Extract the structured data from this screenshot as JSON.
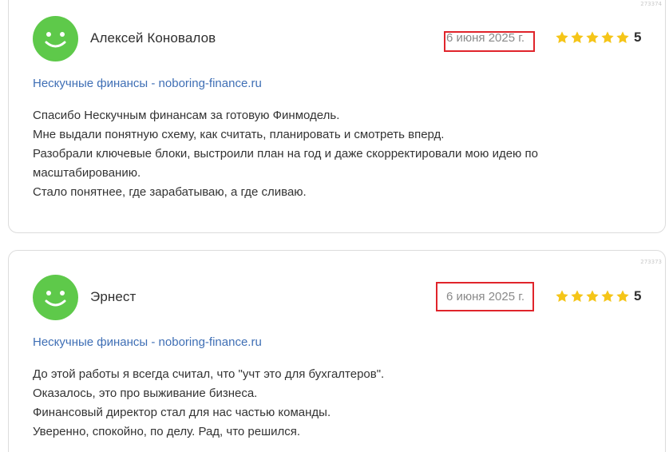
{
  "reviews": [
    {
      "id": "273374",
      "author": "Алексей Коновалов",
      "date": "6 июня 2025 г.",
      "rating": "5",
      "stars": 5,
      "source": "Нескучные финансы - noboring-finance.ru",
      "text": [
        "Спасибо Нескучным финансам за готовую Финмодель.",
        "Мне выдали понятную схему, как считать, планировать и смотреть вперд.",
        "Разобрали ключевые блоки, выстроили план на год и даже скорректировали мою идею по",
        "масштабированию.",
        "Стало понятнее, где зарабатываю, а где сливаю."
      ]
    },
    {
      "id": "273373",
      "author": "Эрнест",
      "date": "6 июня 2025 г.",
      "rating": "5",
      "stars": 5,
      "source": "Нескучные финансы - noboring-finance.ru",
      "text": [
        "До этой работы я всегда считал, что \"учт  это для бухгалтеров\".",
        "Оказалось, это про выживание бизнеса.",
        "Финансовый директор стал для нас частью команды.",
        "Уверенно, спокойно, по делу. Рад, что решился."
      ]
    }
  ],
  "colors": {
    "avatar": "#5ec94a",
    "star": "#f5c518",
    "link": "#3f6fb5",
    "highlight": "#e0242b"
  },
  "icons": {
    "avatar": "smiley-face-icon",
    "star": "star-icon"
  }
}
